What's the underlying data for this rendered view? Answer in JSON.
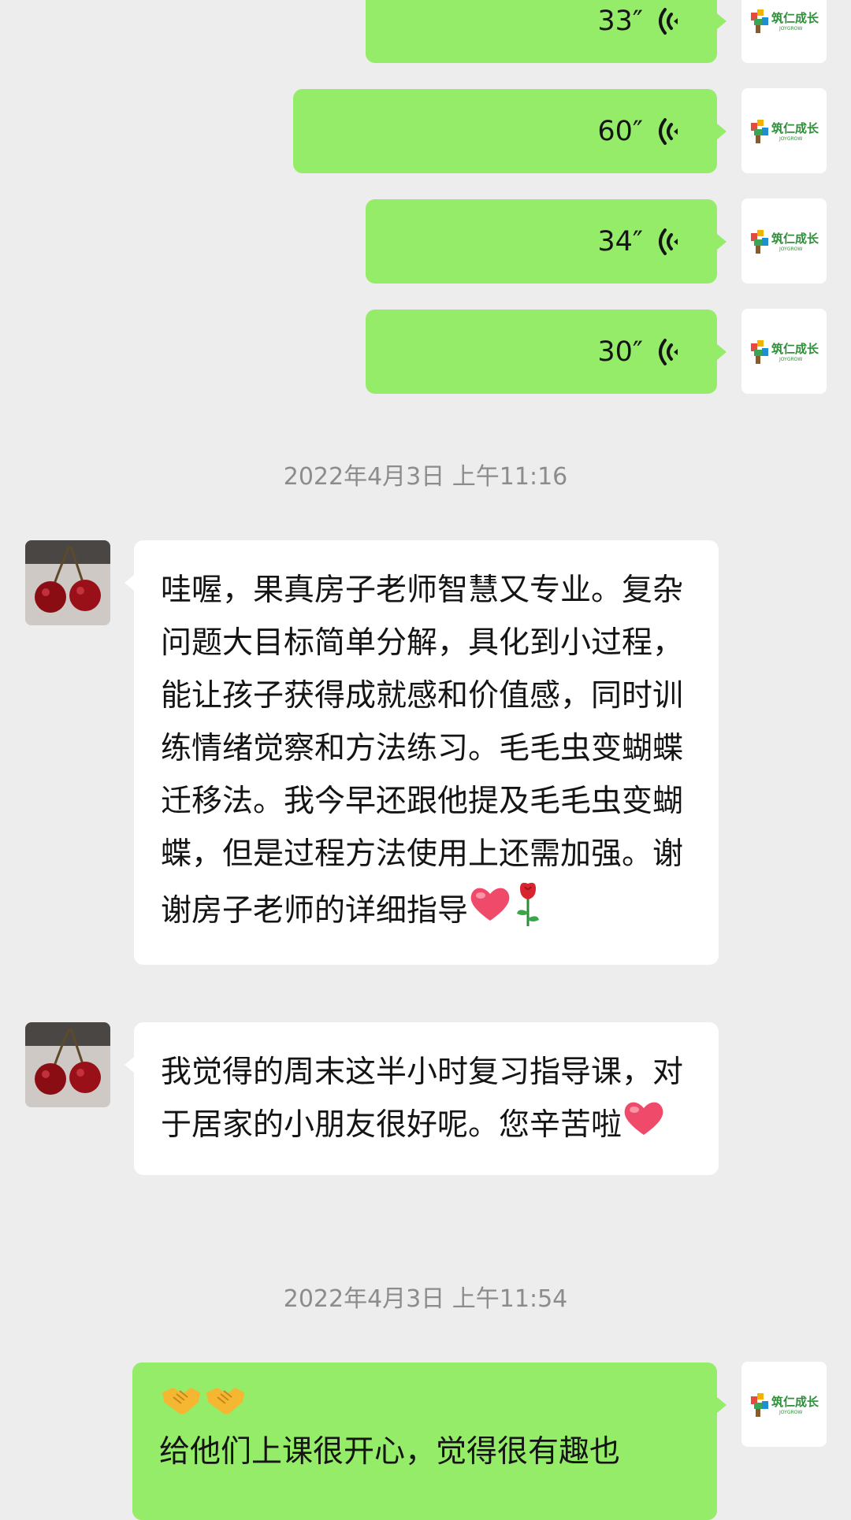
{
  "messages": {
    "voice": [
      {
        "duration": "33″"
      },
      {
        "duration": "60″"
      },
      {
        "duration": "34″"
      },
      {
        "duration": "30″"
      }
    ],
    "timestamp_1": "2022年4月3日 上午11:16",
    "received_1": {
      "text": "哇喔，果真房子老师智慧又专业。复杂问题大目标简单分解，具化到小过程，能让孩子获得成就感和价值感，同时训练情绪觉察和方法练习。毛毛虫变蝴蝶迁移法。我今早还跟他提及毛毛虫变蝴蝶，但是过程方法使用上还需加强。谢谢房子老师的详细指导"
    },
    "received_2": {
      "text": "我觉得的周末这半小时复习指导课，对于居家的小朋友很好呢。您辛苦啦"
    },
    "timestamp_2": "2022年4月3日 上午11:54",
    "sent_1": {
      "text": "给他们上课很开心，觉得很有趣也"
    }
  },
  "icons": {
    "sender_avatar": "joygrow-logo-icon",
    "receiver_avatar": "cherries-icon",
    "voice": "voice-wave-icon",
    "heart": "red-heart-icon",
    "rose": "rose-icon",
    "handshake": "handshake-icon"
  },
  "logo": {
    "chinese": "筑仁成长",
    "english": "JOYGROW"
  },
  "colors": {
    "background": "#ededed",
    "sent_bubble": "#95ec69",
    "received_bubble": "#ffffff",
    "timestamp": "#8c8c8c"
  }
}
